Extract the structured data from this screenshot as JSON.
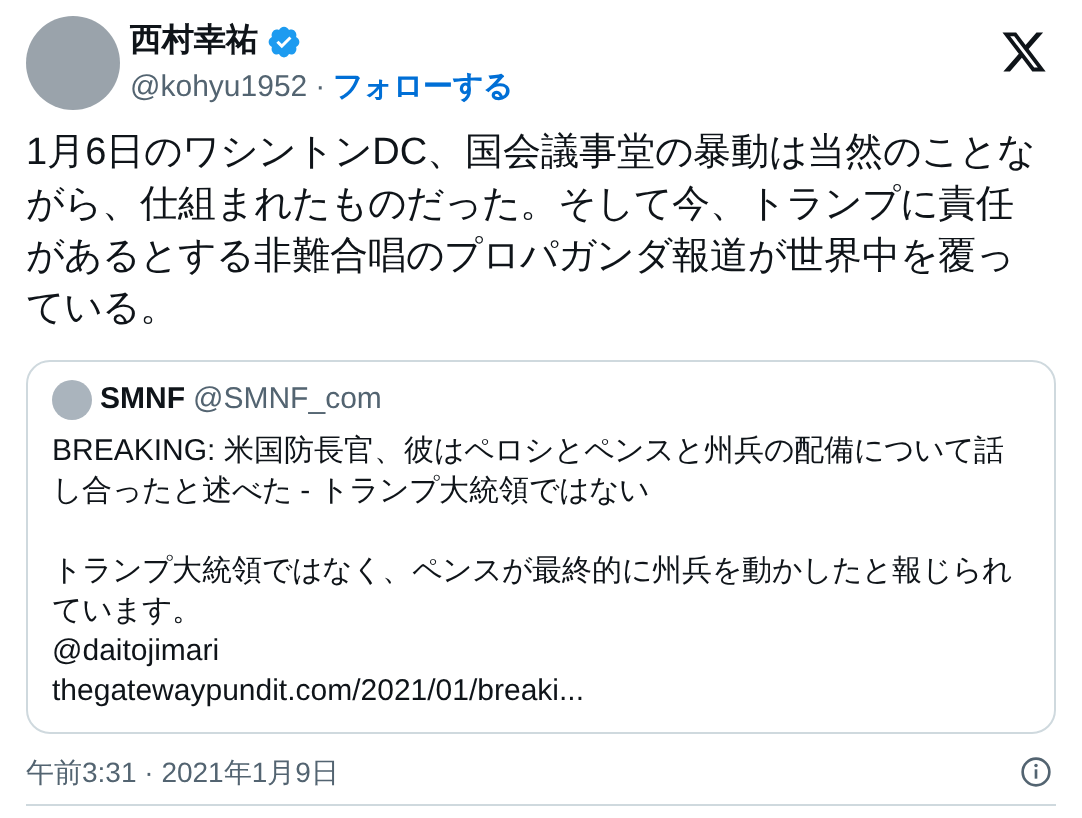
{
  "author": {
    "name": "西村幸祐",
    "verified": true,
    "handle": "@kohyu1952",
    "separator": "·",
    "follow": "フォローする"
  },
  "text": "1月6日のワシントンDC、国会議事堂の暴動は当然のことながら、仕組まれたものだった。そして今、トランプに責任があるとする非難合唱のプロパガンダ報道が世界中を覆っている。",
  "quote": {
    "name": "SMNF",
    "handle": "@SMNF_com",
    "paragraphs": [
      "BREAKING: 米国防長官、彼はペロシとペンスと州兵の配備について話し合ったと述べた - トランプ大統領ではない",
      "トランプ大統領ではなく、ペンスが最終的に州兵を動かしたと報じられています。"
    ],
    "mention": "@daitojimari",
    "link": "thegatewaypundit.com/2021/01/breaki..."
  },
  "timestamp": "午前3:31 · 2021年1月9日"
}
